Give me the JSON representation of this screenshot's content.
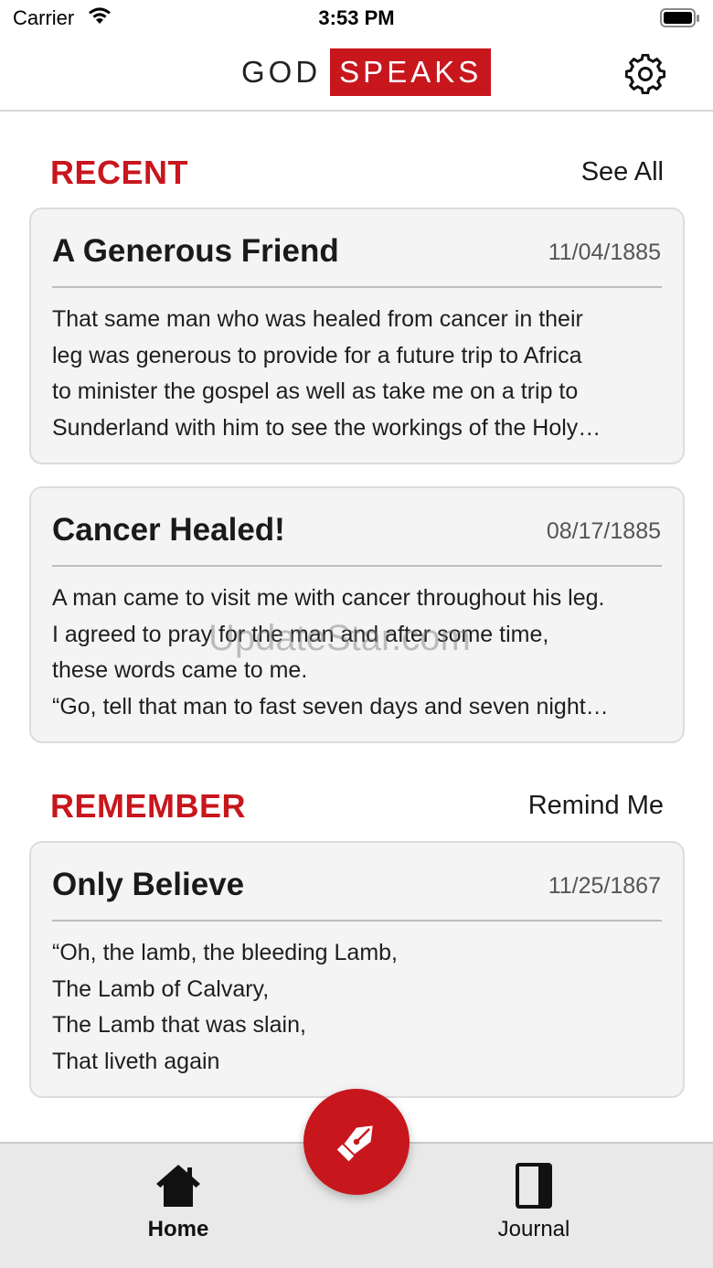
{
  "status_bar": {
    "carrier": "Carrier",
    "time": "3:53 PM"
  },
  "header": {
    "logo_god": "GOD",
    "logo_speaks": "SPEAKS",
    "settings_icon": "gear-icon",
    "brand_color": "#c8161d"
  },
  "recent": {
    "title": "RECENT",
    "action": "See All",
    "cards": [
      {
        "title": "A Generous Friend",
        "date": "11/04/1885",
        "lines": [
          "That same man who was healed from cancer in their",
          "leg was generous to provide for a future trip to Africa",
          "to minister the gospel as well as take me on a trip to",
          "Sunderland with him to see the workings of the Holy…"
        ]
      },
      {
        "title": "Cancer Healed!",
        "date": "08/17/1885",
        "lines": [
          "A man came to visit me with cancer throughout his leg.",
          "I agreed to pray for the man and after some time,",
          "these words came to me.",
          "“Go, tell that man to fast seven days and seven night…"
        ]
      }
    ]
  },
  "remember": {
    "title": "REMEMBER",
    "action": "Remind Me",
    "card": {
      "title": "Only Believe",
      "date": "11/25/1867",
      "lines": [
        "“Oh, the lamb, the bleeding Lamb,",
        "The Lamb of Calvary,",
        "The Lamb that was slain,",
        "That liveth again"
      ]
    }
  },
  "watermark": "UpdateStar.com",
  "fab": {
    "icon": "fountain-pen-icon"
  },
  "tabbar": {
    "items": [
      {
        "label": "Home",
        "icon": "home-icon",
        "active": true
      },
      {
        "label": "Journal",
        "icon": "book-icon",
        "active": false
      }
    ]
  }
}
